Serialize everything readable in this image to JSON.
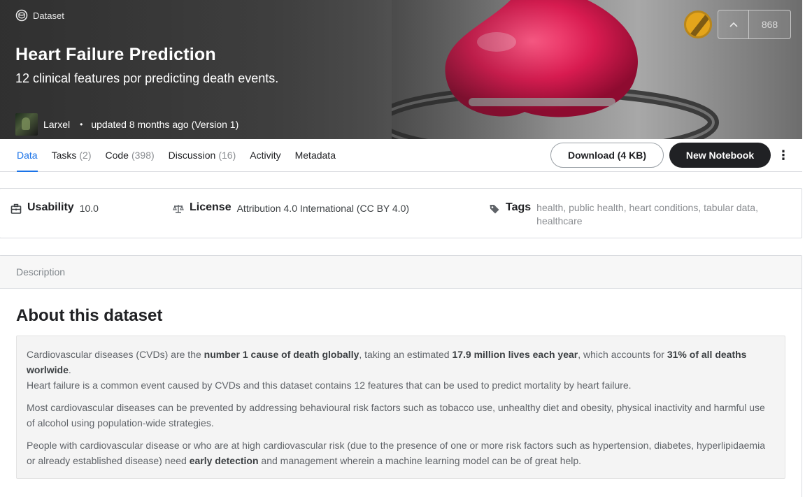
{
  "hero": {
    "kind_label": "Dataset",
    "title": "Heart Failure Prediction",
    "subtitle": "12 clinical features por predicting death events.",
    "owner": "Larxel",
    "updated": "updated 8 months ago (Version 1)",
    "upvote_count": "868",
    "colors": {
      "heart": "#d81b50",
      "medal": "#e4a51b"
    }
  },
  "tabs": [
    {
      "label": "Data",
      "count": ""
    },
    {
      "label": "Tasks",
      "count": "(2)"
    },
    {
      "label": "Code",
      "count": "(398)"
    },
    {
      "label": "Discussion",
      "count": "(16)"
    },
    {
      "label": "Activity",
      "count": ""
    },
    {
      "label": "Metadata",
      "count": ""
    }
  ],
  "actions": {
    "download_label": "Download (4 KB)",
    "new_notebook_label": "New Notebook",
    "more_icon": "more-vert-icon"
  },
  "meta": {
    "usability_label": "Usability",
    "usability_value": "10.0",
    "license_label": "License",
    "license_value": "Attribution 4.0 International (CC BY 4.0)",
    "tags_label": "Tags",
    "tags": [
      "health",
      "public health",
      "heart conditions",
      "tabular data",
      "healthcare"
    ]
  },
  "description": {
    "section_label": "Description",
    "about_title": "About this dataset",
    "p1": {
      "t1": "Cardiovascular diseases (CVDs) are the ",
      "b1": "number 1 cause of death globally",
      "t2": ", taking an estimated ",
      "b2": "17.9 million lives each year",
      "t3": ", which accounts for ",
      "b3": "31% of all deaths worlwide",
      "t4": "."
    },
    "p2": "Heart failure is a common event caused by CVDs and this dataset contains 12 features that can be used to predict mortality by heart failure.",
    "p3": "Most cardiovascular diseases can be prevented by addressing behavioural risk factors such as tobacco use, unhealthy diet and obesity, physical inactivity and harmful use of alcohol using population-wide strategies.",
    "p4": {
      "t1": "People with cardiovascular disease or who are at high cardiovascular risk (due to the presence of one or more risk factors such as hypertension, diabetes, hyperlipidaemia or already established disease) need ",
      "b1": "early detection",
      "t2": " and management wherein a machine learning model can be of great help."
    }
  }
}
